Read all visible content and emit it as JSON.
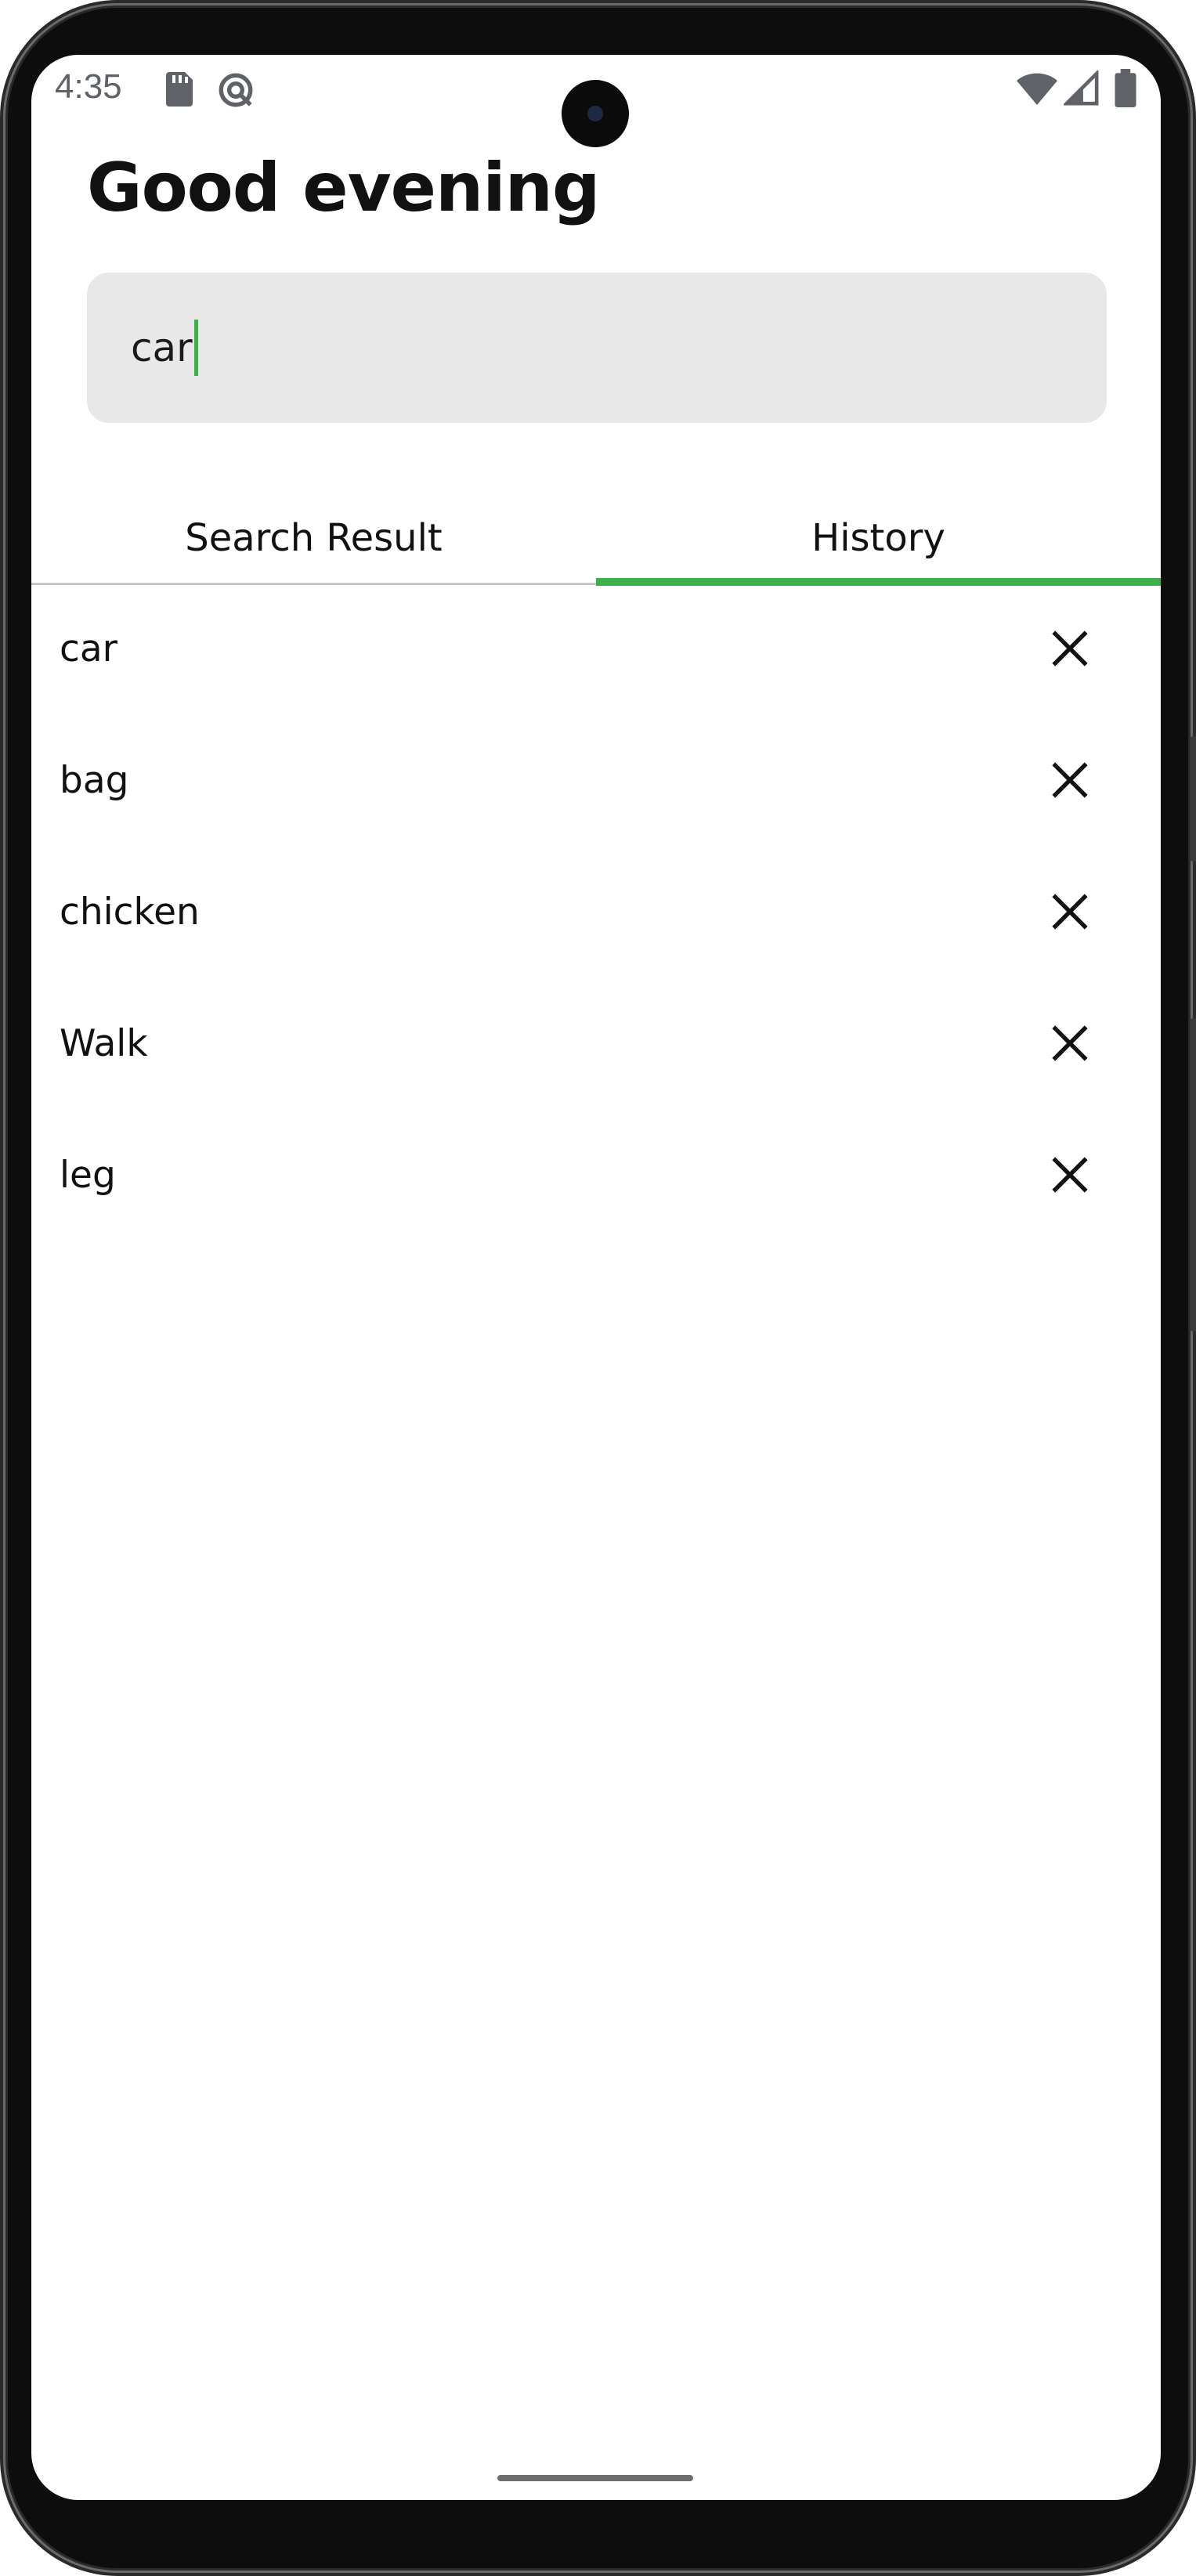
{
  "status_bar": {
    "time": "4:35",
    "left_icons": [
      "sd-card-icon",
      "data-saver-icon"
    ],
    "right_icons": [
      "wifi-icon",
      "cell-signal-icon",
      "battery-icon"
    ]
  },
  "header": {
    "greeting": "Good evening"
  },
  "search": {
    "value": "car"
  },
  "tabs": [
    {
      "label": "Search Result",
      "selected": false
    },
    {
      "label": "History",
      "selected": true
    }
  ],
  "history": {
    "items": [
      {
        "label": "car"
      },
      {
        "label": "bag"
      },
      {
        "label": "chicken"
      },
      {
        "label": "Walk"
      },
      {
        "label": "leg"
      }
    ],
    "remove_icon": "close-icon"
  },
  "colors": {
    "accent": "#3db14a",
    "search_bg": "#e8e8e8",
    "text": "#111111"
  }
}
